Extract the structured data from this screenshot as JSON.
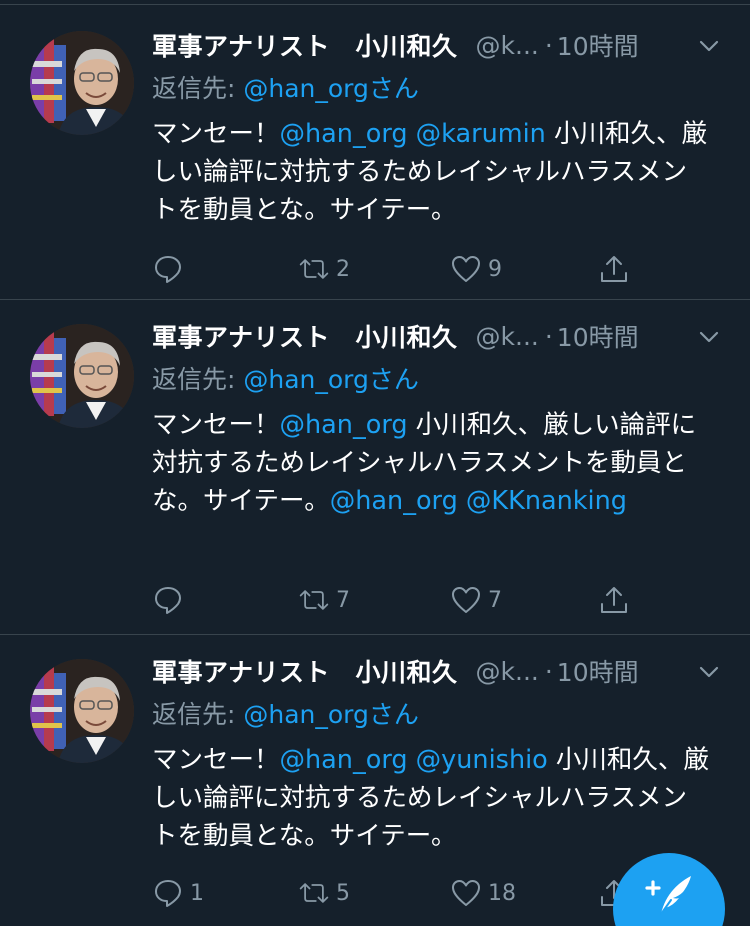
{
  "colors": {
    "background": "#15202b",
    "divider": "#38444d",
    "secondary_text": "#8899a6",
    "accent": "#1da1f2"
  },
  "tweets": [
    {
      "display_name": "軍事アナリスト　小川和久",
      "handle": "@k...",
      "separator": "·",
      "time": "10時間",
      "reply_prefix": "返信先: ",
      "reply_handle": "@han_orgさん",
      "body_parts": [
        {
          "text": "マンセー！",
          "link": false
        },
        {
          "text": "@han_org",
          "link": true
        },
        {
          "text": " ",
          "link": false
        },
        {
          "text": "@karumin",
          "link": true
        },
        {
          "text": " 小川和久、厳しい論評に対抗するためレイシャルハラスメントを動員とな。サイテー。",
          "link": false
        }
      ],
      "reply_count": "",
      "retweet_count": "2",
      "like_count": "9",
      "avatar_icon": "profile-photo"
    },
    {
      "display_name": "軍事アナリスト　小川和久",
      "handle": "@k...",
      "separator": "·",
      "time": "10時間",
      "reply_prefix": "返信先: ",
      "reply_handle": "@han_orgさん",
      "body_parts": [
        {
          "text": "マンセー！",
          "link": false
        },
        {
          "text": "@han_org",
          "link": true
        },
        {
          "text": "  小川和久、厳しい論評に対抗するためレイシャルハラスメントを動員とな。サイテー。",
          "link": false
        },
        {
          "text": "@han_org",
          "link": true
        },
        {
          "text": " ",
          "link": false
        },
        {
          "text": "@KKnanking",
          "link": true
        }
      ],
      "reply_count": "",
      "retweet_count": "7",
      "like_count": "7",
      "avatar_icon": "profile-photo"
    },
    {
      "display_name": "軍事アナリスト　小川和久",
      "handle": "@k...",
      "separator": "·",
      "time": "10時間",
      "reply_prefix": "返信先: ",
      "reply_handle": "@han_orgさん",
      "body_parts": [
        {
          "text": "マンセー！",
          "link": false
        },
        {
          "text": "@han_org",
          "link": true
        },
        {
          "text": " ",
          "link": false
        },
        {
          "text": "@yunishio",
          "link": true
        },
        {
          "text": " 小川和久、厳しい論評に対抗するためレイシャルハラスメントを動員とな。サイテー。",
          "link": false
        }
      ],
      "reply_count": "1",
      "retweet_count": "5",
      "like_count": "18",
      "avatar_icon": "profile-photo"
    }
  ],
  "compose_button": {
    "icon": "compose-tweet-icon"
  }
}
